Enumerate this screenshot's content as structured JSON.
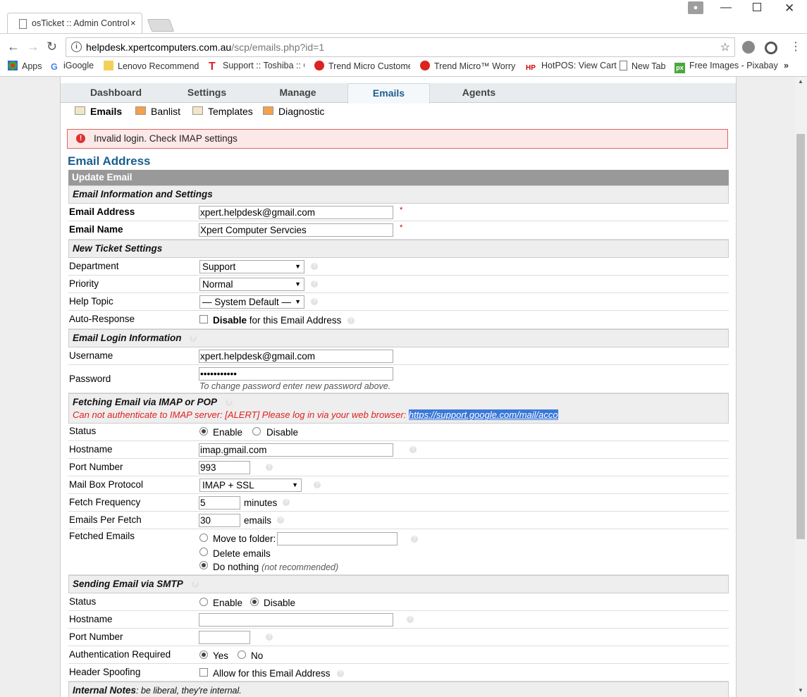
{
  "browser": {
    "tab_title": "osTicket :: Admin Control",
    "tab_close": "×",
    "url_host": "helpdesk.xpertcomputers.com.au",
    "url_path": "/scp/emails.php?id=1",
    "bookmarks": [
      "Apps",
      "iGoogle",
      "Lenovo Recommende",
      "Support :: Toshiba :: C",
      "Trend Micro Custome",
      "Trend Micro™ Worry-F",
      "HotPOS: View Cart",
      "New Tab",
      "Free Images - Pixabay"
    ],
    "more_bookmarks": "»"
  },
  "nav": {
    "tabs": [
      "Dashboard",
      "Settings",
      "Manage",
      "Emails",
      "Agents"
    ],
    "active_tab": "Emails",
    "subnav": [
      "Emails",
      "Banlist",
      "Templates",
      "Diagnostic"
    ]
  },
  "error_message": "Invalid login. Check IMAP settings",
  "page_title": "Email Address",
  "form": {
    "header": "Update Email",
    "sections": {
      "info": "Email Information and Settings",
      "ticket": "New Ticket Settings",
      "login": "Email Login Information",
      "fetch": "Fetching Email via IMAP or POP",
      "smtp": "Sending Email via SMTP",
      "notes_label": "Internal Notes",
      "notes_hint": ": be liberal, they're internal."
    },
    "fetch_error": "Can not authenticate to IMAP server: [ALERT] Please log in via your web browser: ",
    "fetch_error_link": "https://support.google.com/mail/acco",
    "labels": {
      "email_address": "Email Address",
      "email_name": "Email Name",
      "department": "Department",
      "priority": "Priority",
      "help_topic": "Help Topic",
      "auto_response": "Auto-Response",
      "username": "Username",
      "password": "Password",
      "status": "Status",
      "hostname": "Hostname",
      "port": "Port Number",
      "protocol": "Mail Box Protocol",
      "frequency": "Fetch Frequency",
      "per_fetch": "Emails Per Fetch",
      "fetched": "Fetched Emails",
      "auth_required": "Authentication Required",
      "header_spoofing": "Header Spoofing"
    },
    "values": {
      "email_address": "xpert.helpdesk@gmail.com",
      "email_name": "Xpert Computer Servcies",
      "department": "Support",
      "priority": "Normal",
      "help_topic": "— System Default —",
      "username": "xpert.helpdesk@gmail.com",
      "password": "•••••••••••",
      "fetch_hostname": "imap.gmail.com",
      "fetch_port": "993",
      "protocol": "IMAP + SSL",
      "frequency": "5",
      "per_fetch": "30"
    },
    "required_mark": "*",
    "auto_response_bold": "Disable",
    "auto_response_rest": " for this Email Address",
    "password_hint": "To change password enter new password above.",
    "enable": "Enable",
    "disable": "Disable",
    "minutes": "minutes",
    "emails_unit": "emails",
    "move_to_folder": "Move to folder:",
    "delete_emails": "Delete emails",
    "do_nothing": "Do nothing",
    "not_recommended": "(not recommended)",
    "yes": "Yes",
    "no": "No",
    "allow_spoofing": "Allow for this Email Address"
  }
}
